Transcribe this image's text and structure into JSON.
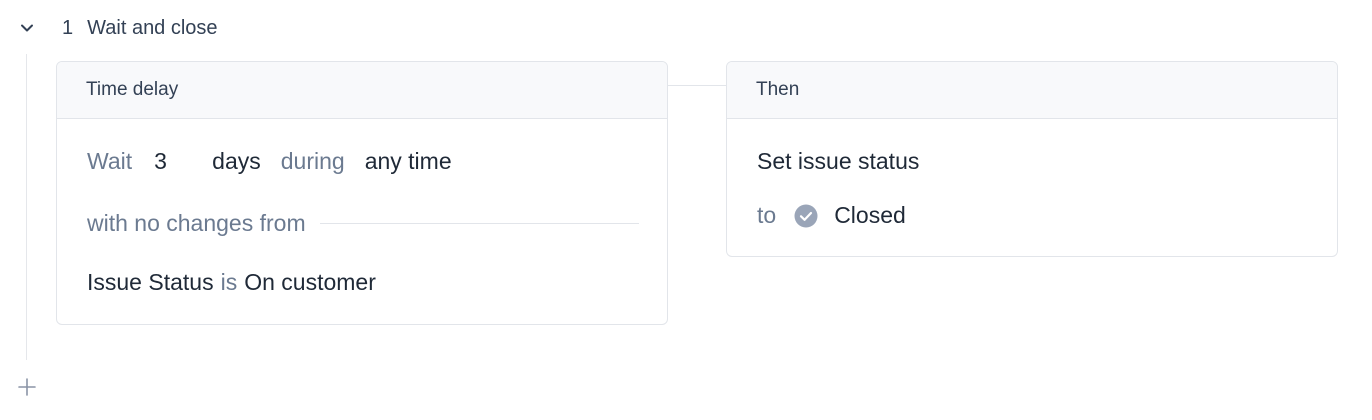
{
  "section": {
    "number": "1",
    "title": "Wait and close"
  },
  "time_delay": {
    "header": "Time delay",
    "wait_label": "Wait",
    "wait_value": "3",
    "unit": "days",
    "during_label": "during",
    "during_value": "any time",
    "no_changes_label": "with no changes from",
    "condition": {
      "field": "Issue Status",
      "operator": "is",
      "value": "On customer"
    }
  },
  "then": {
    "header": "Then",
    "action": "Set issue status",
    "to_label": "to",
    "status_icon": "check-circle-icon",
    "status_value": "Closed"
  },
  "colors": {
    "muted_text": "#6b7a90",
    "status_icon": "#9aa5b8",
    "border": "#e2e5ea",
    "header_bg": "#f8f9fb"
  }
}
